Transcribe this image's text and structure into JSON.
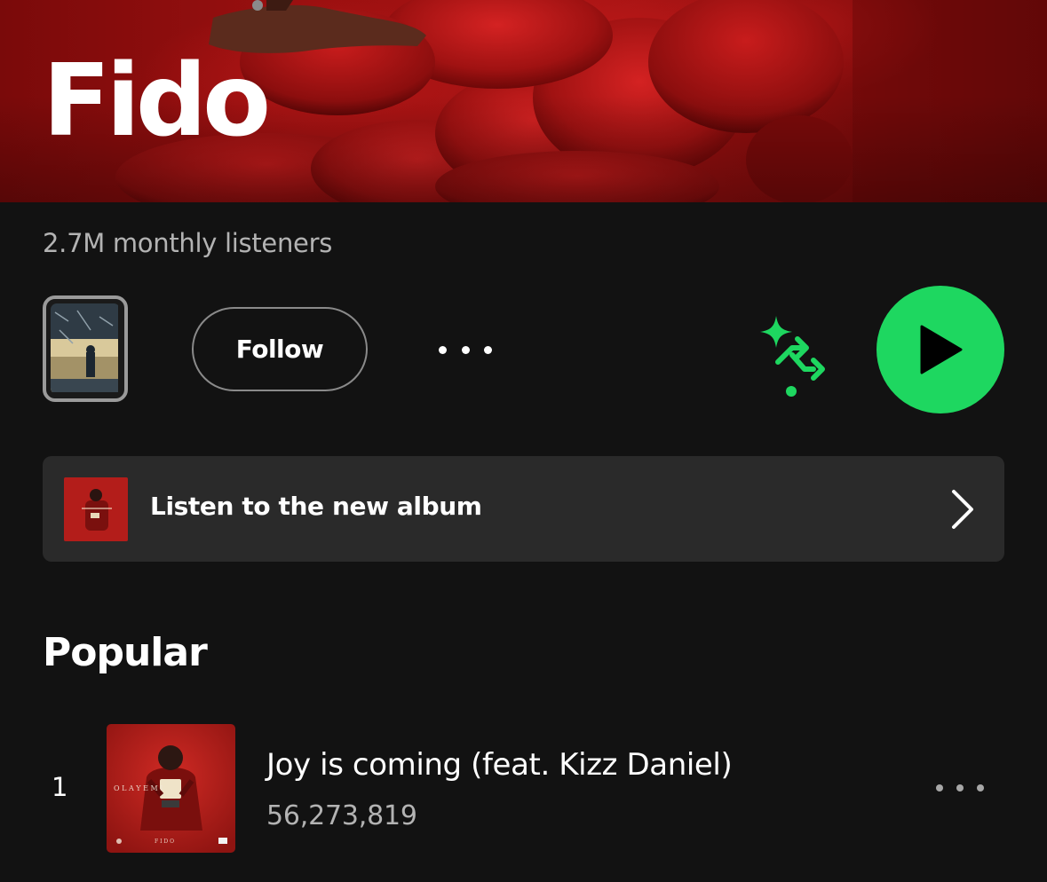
{
  "artist": {
    "name": "Fido",
    "monthly_listeners": "2.7M monthly listeners"
  },
  "actions": {
    "follow_label": "Follow",
    "more_icon": "more-horizontal-icon",
    "shuffle_icon": "smart-shuffle-icon",
    "play_icon": "play-icon"
  },
  "new_album_banner": {
    "label": "Listen to the new album",
    "chevron_icon": "chevron-right-icon"
  },
  "popular": {
    "heading": "Popular",
    "tracks": [
      {
        "rank": "1",
        "title": "Joy is coming (feat. Kizz Daniel)",
        "plays": "56,273,819",
        "cover_text": "O L A Y E M I",
        "cover_artist": "F I D O"
      }
    ]
  },
  "colors": {
    "background": "#121212",
    "accent_green": "#1ed760",
    "banner_bg": "#2a2a2a",
    "secondary_text": "#b3b3b3",
    "hero_red": "#a71313"
  }
}
